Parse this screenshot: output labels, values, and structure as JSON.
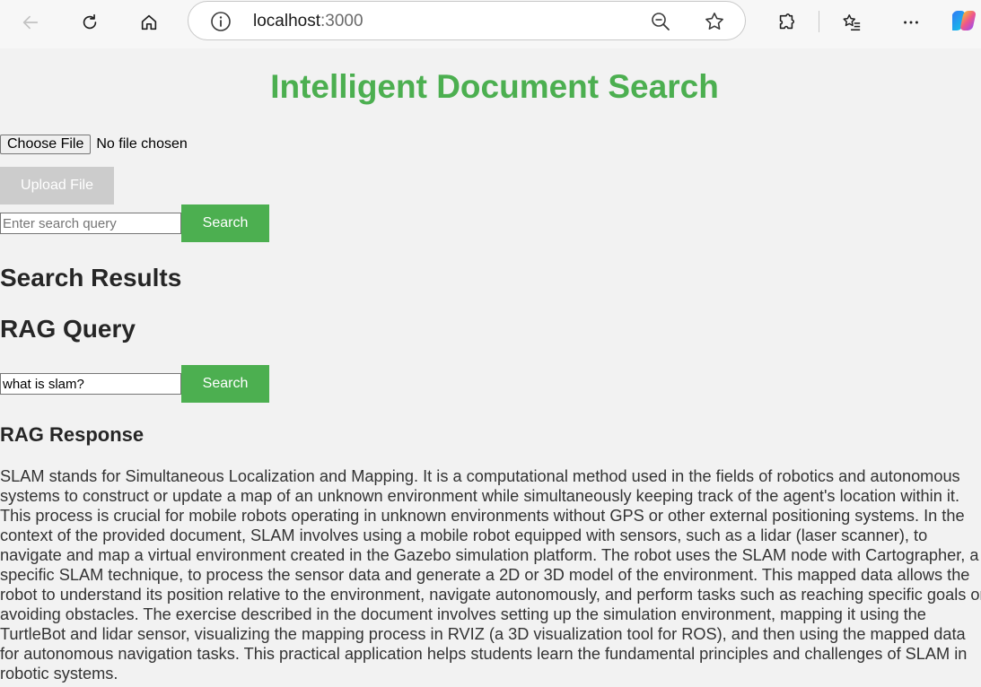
{
  "browser": {
    "url_host": "localhost",
    "url_port": ":3000",
    "icons": [
      "back-icon",
      "refresh-icon",
      "home-icon",
      "info-icon",
      "zoom-out-icon",
      "favorite-star-icon",
      "extensions-icon",
      "favorites-list-icon",
      "more-icon",
      "copilot-icon"
    ]
  },
  "page": {
    "title": "Intelligent Document Search",
    "file_input": {
      "button_label": "Choose File",
      "status": "No file chosen"
    },
    "upload_label": "Upload File",
    "search": {
      "placeholder": "Enter search query",
      "value": "",
      "button_label": "Search"
    },
    "results_heading": "Search Results",
    "rag_heading": "RAG Query",
    "rag": {
      "value": "what is slam?",
      "button_label": "Search"
    },
    "rag_response_heading": "RAG Response",
    "rag_response_text": "SLAM stands for Simultaneous Localization and Mapping. It is a computational method used in the fields of robotics and autonomous systems to construct or update a map of an unknown environment while simultaneously keeping track of the agent's location within it. This process is crucial for mobile robots operating in unknown environments without GPS or other external positioning systems. In the context of the provided document, SLAM involves using a mobile robot equipped with sensors, such as a lidar (laser scanner), to navigate and map a virtual environment created in the Gazebo simulation platform. The robot uses the SLAM node with Cartographer, a specific SLAM technique, to process the sensor data and generate a 2D or 3D model of the environment. This mapped data allows the robot to understand its position relative to the environment, navigate autonomously, and perform tasks such as reaching specific goals or avoiding obstacles. The exercise described in the document involves setting up the simulation environment, mapping it using the TurtleBot and lidar sensor, visualizing the mapping process in RVIZ (a 3D visualization tool for ROS), and then using the mapped data for autonomous navigation tasks. This practical application helps students learn the fundamental principles and challenges of SLAM in robotic systems."
  },
  "colors": {
    "accent": "#4caf50",
    "disabled_button": "#cccccc",
    "background": "#f2f2f2"
  }
}
